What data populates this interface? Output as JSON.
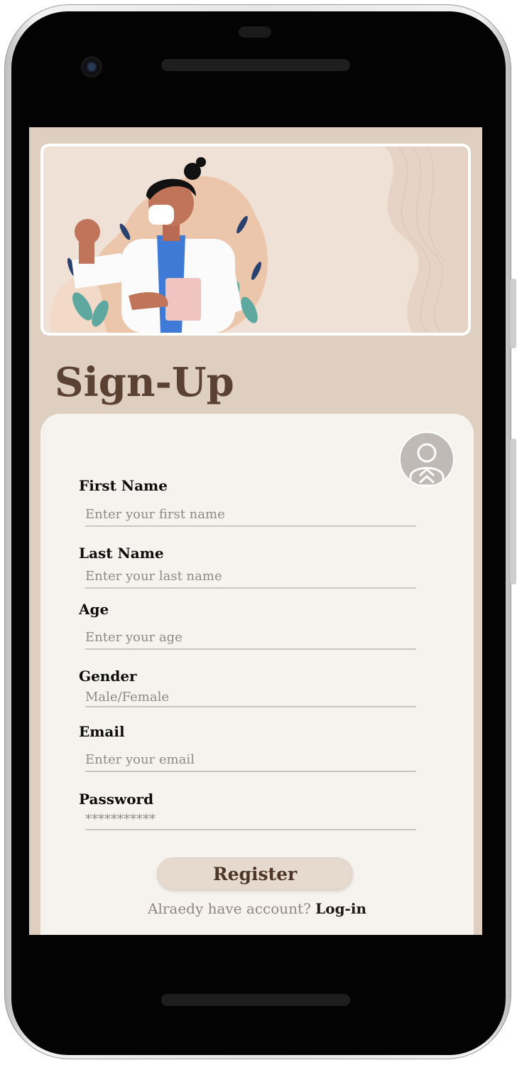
{
  "signup": {
    "title": "Sign-Up",
    "fields": [
      {
        "label": "First Name",
        "placeholder": "Enter your first name",
        "value": ""
      },
      {
        "label": "Last Name",
        "placeholder": "Enter your last name",
        "value": ""
      },
      {
        "label": "Age",
        "placeholder": "Enter your age",
        "value": ""
      },
      {
        "label": "Gender",
        "placeholder": "Male/Female",
        "value": ""
      },
      {
        "label": "Email",
        "placeholder": "Enter your email",
        "value": ""
      },
      {
        "label": "Password",
        "placeholder": "***********",
        "value": ""
      }
    ],
    "register_label": "Register",
    "login_prompt": "Alraedy have account?",
    "login_link": "Log-in"
  },
  "icons": {
    "avatar": "user-upload-icon",
    "banner": "doctor-illustration"
  },
  "colors": {
    "background": "#dfcfc0",
    "card": "#f6f2ed",
    "title": "#5a4131",
    "button": "#e6d9cd"
  }
}
